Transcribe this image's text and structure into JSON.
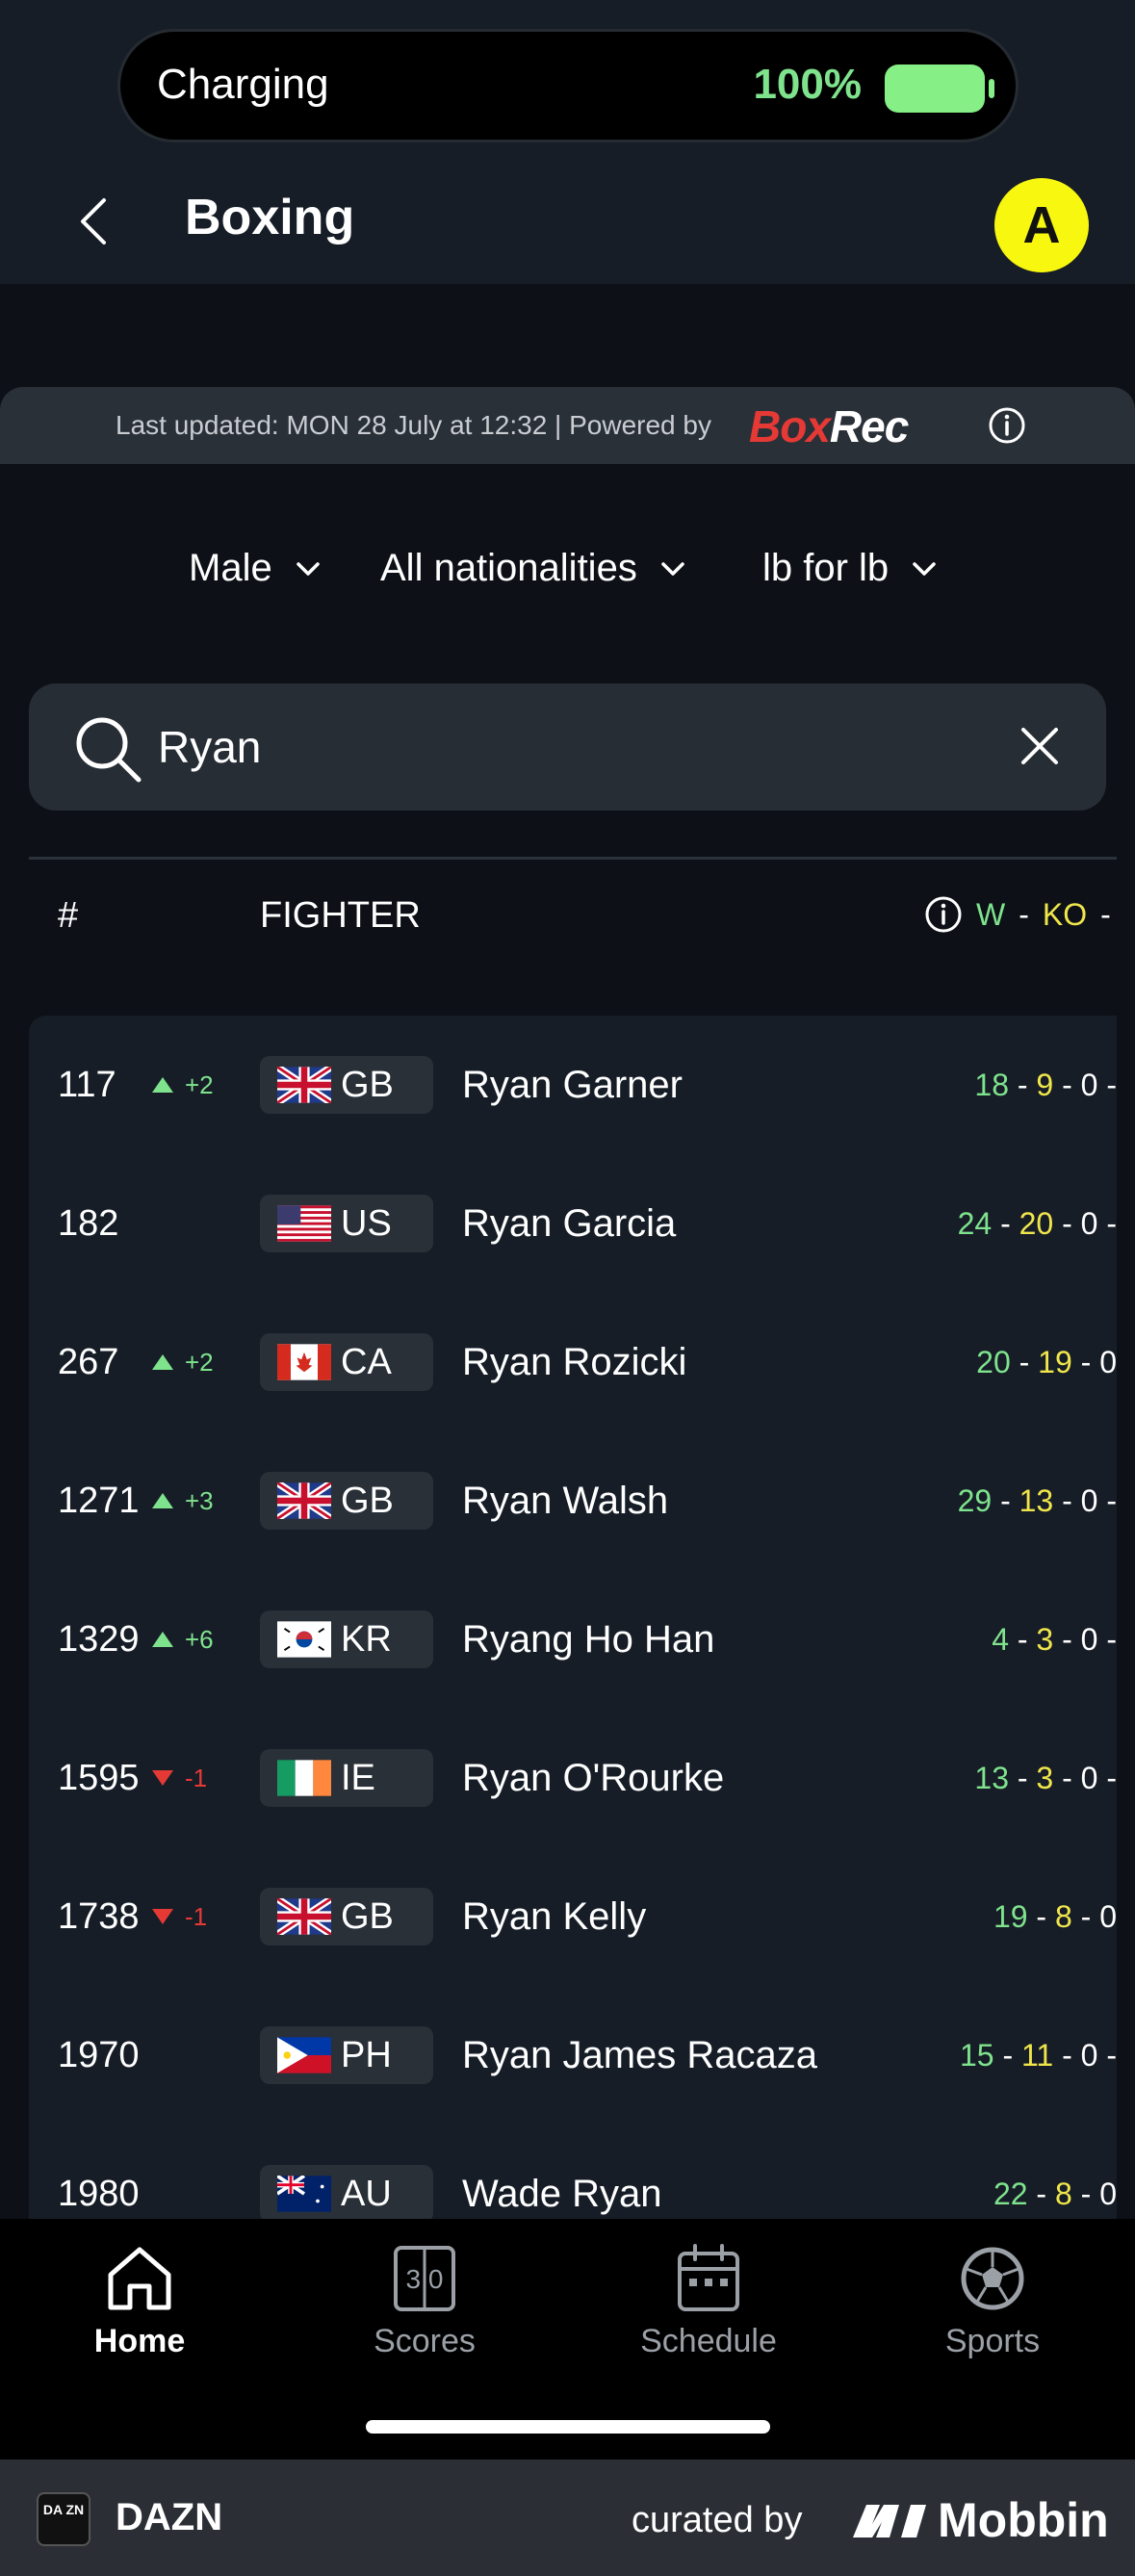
{
  "status": {
    "charging_label": "Charging",
    "battery_percent": "100%"
  },
  "header": {
    "title": "Boxing",
    "avatar_initial": "A"
  },
  "updated_bar": {
    "text": "Last updated: MON 28 July at 12:32  |  Powered by",
    "brand_a": "Box",
    "brand_b": "Rec"
  },
  "filters": {
    "gender": "Male",
    "nationality": "All nationalities",
    "weight": "lb for lb"
  },
  "search": {
    "value": "Ryan"
  },
  "table_header": {
    "rank": "#",
    "fighter": "FIGHTER",
    "win": "W",
    "dash": "-",
    "ko": "KO",
    "dash2": "-"
  },
  "fighters": [
    {
      "rank": "117",
      "trend": "up",
      "delta": "+2",
      "nat": "GB",
      "name": "Ryan Garner",
      "w": "18",
      "ko": "9",
      "rest": " - 0 -"
    },
    {
      "rank": "182",
      "trend": "none",
      "delta": "",
      "nat": "US",
      "name": "Ryan Garcia",
      "w": "24",
      "ko": "20",
      "rest": " - 0 -"
    },
    {
      "rank": "267",
      "trend": "up",
      "delta": "+2",
      "nat": "CA",
      "name": "Ryan Rozicki",
      "w": "20",
      "ko": "19",
      "rest": " - 0"
    },
    {
      "rank": "1271",
      "trend": "up",
      "delta": "+3",
      "nat": "GB",
      "name": "Ryan Walsh",
      "w": "29",
      "ko": "13",
      "rest": " - 0 -"
    },
    {
      "rank": "1329",
      "trend": "up",
      "delta": "+6",
      "nat": "KR",
      "name": "Ryang Ho Han",
      "w": "4",
      "ko": "3",
      "rest": " - 0 -"
    },
    {
      "rank": "1595",
      "trend": "down",
      "delta": "-1",
      "nat": "IE",
      "name": "Ryan O'Rourke",
      "w": "13",
      "ko": "3",
      "rest": " - 0 -"
    },
    {
      "rank": "1738",
      "trend": "down",
      "delta": "-1",
      "nat": "GB",
      "name": "Ryan Kelly",
      "w": "19",
      "ko": "8",
      "rest": " - 0"
    },
    {
      "rank": "1970",
      "trend": "none",
      "delta": "",
      "nat": "PH",
      "name": "Ryan James Racaza",
      "w": "15",
      "ko": "11",
      "rest": " - 0 -"
    },
    {
      "rank": "1980",
      "trend": "none",
      "delta": "",
      "nat": "AU",
      "name": "Wade Ryan",
      "w": "22",
      "ko": "8",
      "rest": " - 0"
    }
  ],
  "nav": {
    "home": "Home",
    "scores": "Scores",
    "schedule": "Schedule",
    "sports": "Sports",
    "scores_icon_text": "3 0"
  },
  "footer": {
    "app_name": "DAZN",
    "logo_text": "DA ZN",
    "curated": "curated by",
    "mobbin": "Mobbin"
  },
  "colors": {
    "win": "#7fe38d",
    "ko": "#f0e64b",
    "down": "#e53935",
    "avatar": "#f8f70f",
    "boxrec_red": "#e53935"
  }
}
